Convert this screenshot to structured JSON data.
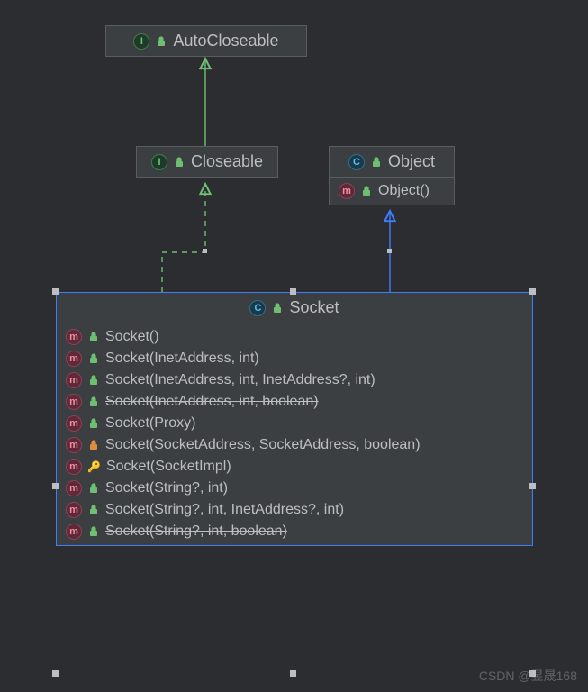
{
  "nodes": {
    "autocloseable": {
      "type": "interface",
      "name": "AutoCloseable"
    },
    "closeable": {
      "type": "interface",
      "name": "Closeable"
    },
    "object": {
      "type": "class",
      "name": "Object",
      "methods": [
        {
          "name": "Object()",
          "access": "public",
          "deprecated": false
        }
      ]
    },
    "socket": {
      "type": "class",
      "name": "Socket",
      "methods": [
        {
          "name": "Socket()",
          "access": "public",
          "deprecated": false
        },
        {
          "name": "Socket(InetAddress, int)",
          "access": "public",
          "deprecated": false
        },
        {
          "name": "Socket(InetAddress, int, InetAddress?, int)",
          "access": "public",
          "deprecated": false
        },
        {
          "name": "Socket(InetAddress, int, boolean)",
          "access": "public",
          "deprecated": true
        },
        {
          "name": "Socket(Proxy)",
          "access": "public",
          "deprecated": false
        },
        {
          "name": "Socket(SocketAddress, SocketAddress, boolean)",
          "access": "private",
          "deprecated": false
        },
        {
          "name": "Socket(SocketImpl)",
          "access": "protected",
          "deprecated": false
        },
        {
          "name": "Socket(String?, int)",
          "access": "public",
          "deprecated": false
        },
        {
          "name": "Socket(String?, int, InetAddress?, int)",
          "access": "public",
          "deprecated": false
        },
        {
          "name": "Socket(String?, int, boolean)",
          "access": "public",
          "deprecated": true
        }
      ]
    }
  },
  "edges": [
    {
      "from": "closeable",
      "to": "autocloseable",
      "kind": "implements"
    },
    {
      "from": "socket",
      "to": "closeable",
      "kind": "implements"
    },
    {
      "from": "socket",
      "to": "object",
      "kind": "extends"
    }
  ],
  "watermark": "CSDN @昱晟168",
  "colors": {
    "bg": "#2b2d30",
    "node_bg": "#3c3f41",
    "border": "#5a5d5f",
    "text": "#bcbec4",
    "interface": "#6fbf73",
    "class": "#4fc3f7",
    "method": "#f28b9b",
    "extends_line": "#3d7eff",
    "implements_line": "#6fbf73"
  }
}
